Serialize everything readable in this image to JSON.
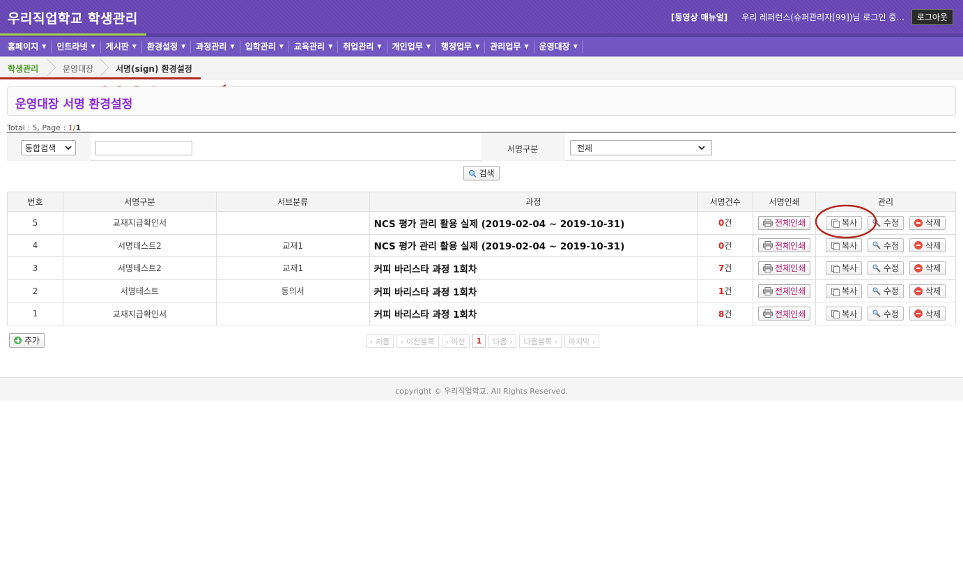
{
  "header": {
    "brand": "우리직업학교 학생관리",
    "video_manual": "[동영상 매뉴얼]",
    "login_info": "우리 레퍼런스(슈퍼관리자[99])님 로그인 중...",
    "logout_label": "로그아웃"
  },
  "nav": {
    "items": [
      "홈페이지",
      "인트라넷",
      "게시판",
      "환경설정",
      "과정관리",
      "입학관리",
      "교육관리",
      "취업관리",
      "개인업무",
      "행정업무",
      "관리업무",
      "운영대장"
    ]
  },
  "breadcrumb": {
    "items": [
      "학생관리",
      "운영대장",
      "서명(sign) 환경설정"
    ]
  },
  "page_title": "운영대장 서명 환경설정",
  "summary": {
    "prefix": "Total : 5, Page : ",
    "current_page": "1",
    "slash": "/",
    "total_pages": "1"
  },
  "search": {
    "type_value": "통합검색",
    "input_value": "",
    "sign_type_label": "서명구분",
    "sign_type_value": "전체",
    "button_label": "검색"
  },
  "table": {
    "headers": [
      "번호",
      "서명구분",
      "서브분류",
      "과정",
      "서명건수",
      "서명인쇄",
      "관리"
    ],
    "rows": [
      {
        "no": "5",
        "sign_type": "교재지급확인서",
        "sub": "",
        "course": "NCS 평가 관리 활용 실제 (2019-02-04 ~ 2019-10-31)",
        "count": "0",
        "unit": "건"
      },
      {
        "no": "4",
        "sign_type": "서명테스트2",
        "sub": "교재1",
        "course": "NCS 평가 관리 활용 실제 (2019-02-04 ~ 2019-10-31)",
        "count": "0",
        "unit": "건"
      },
      {
        "no": "3",
        "sign_type": "서명테스트2",
        "sub": "교재1",
        "course": "커피 바리스타 과정 1회차",
        "count": "7",
        "unit": "건"
      },
      {
        "no": "2",
        "sign_type": "서명테스트",
        "sub": "동의서",
        "course": "커피 바리스타 과정 1회차",
        "count": "1",
        "unit": "건"
      },
      {
        "no": "1",
        "sign_type": "교재지급확인서",
        "sub": "",
        "course": "커피 바리스타 과정 1회차",
        "count": "8",
        "unit": "건"
      }
    ],
    "print_label": "전체인쇄",
    "copy_label": "복사",
    "edit_label": "수정",
    "delete_label": "삭제"
  },
  "add_label": "추가",
  "pager": {
    "first": "‹ 처음",
    "prev_block": "‹ 이전블록",
    "prev": "‹ 이전",
    "current": "1",
    "next": "다음 ›",
    "next_block": "다음블록 ›",
    "last": "마지막 ›"
  },
  "footer": "copyright © 우리직업학교. All Rights Reserved.",
  "colors": {
    "header_purple": "#6d4bb8",
    "title_purple": "#8a2bd1",
    "breadcrumb_green": "#4a9a24",
    "annotation_red": "#b0281c",
    "count_red": "#d0261b"
  }
}
